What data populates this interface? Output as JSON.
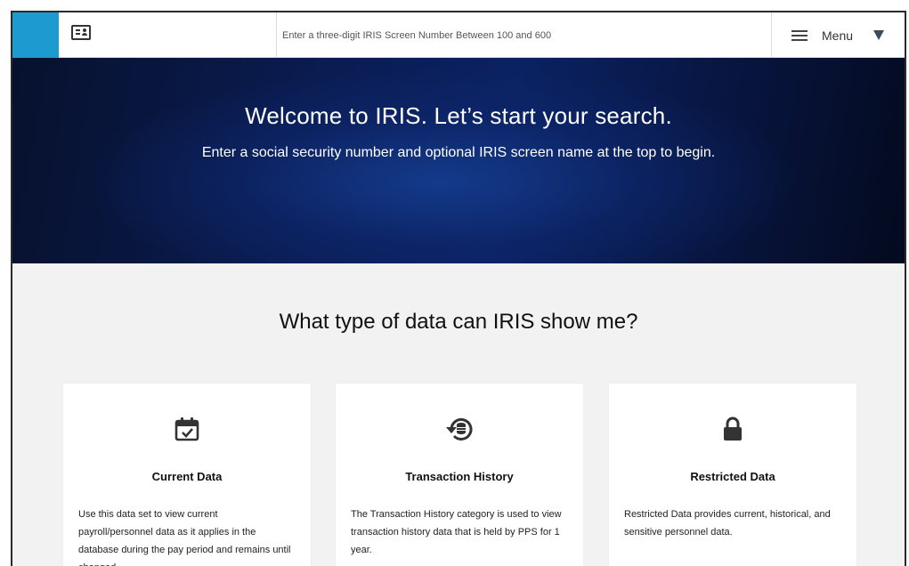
{
  "topbar": {
    "screen_input_placeholder": "Enter a three-digit IRIS Screen Number Between 100 and 600",
    "menu_label": "Menu"
  },
  "hero": {
    "title": "Welcome to IRIS. Let’s start your search.",
    "subtitle": "Enter a social security number and optional IRIS screen name at the top to begin."
  },
  "section": {
    "title": "What type of data can IRIS show me?"
  },
  "cards": [
    {
      "icon": "calendar-check-icon",
      "title": "Current Data",
      "text": "Use this data set to view current payroll/personnel data as it applies in the database during the pay period and remains until changed."
    },
    {
      "icon": "history-database-icon",
      "title": "Transaction History",
      "text": "The Transaction History category is used to view transaction history data that is held by PPS for 1 year."
    },
    {
      "icon": "lock-icon",
      "title": "Restricted Data",
      "text": "Restricted Data provides current, historical, and sensitive personnel data."
    }
  ],
  "colors": {
    "accent_blue": "#1d9bd1",
    "hero_dark": "#07112e",
    "page_bg": "#f2f2f2"
  }
}
